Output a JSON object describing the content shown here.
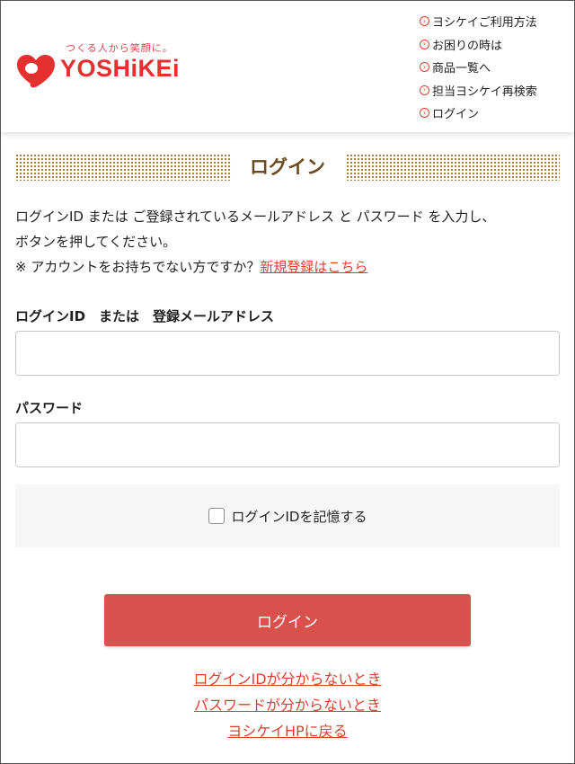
{
  "brand": {
    "tagline": "つくる人から笑顔に。",
    "name": "YOSHiKEi",
    "color": "#e4302f"
  },
  "nav": {
    "items": [
      {
        "label": "ヨシケイご利用方法"
      },
      {
        "label": "お困りの時は"
      },
      {
        "label": "商品一覧へ"
      },
      {
        "label": "担当ヨシケイ再検索"
      },
      {
        "label": "ログイン"
      }
    ],
    "icon": "circle-chevron-right-icon"
  },
  "page": {
    "title": "ログイン",
    "intro_line1": "ログインID または ご登録されているメールアドレス と パスワード を入力し、",
    "intro_line2": "ボタンを押してください。",
    "intro_line3": "※ アカウントをお持ちでない方ですか？",
    "register_link": "新規登録はこちら"
  },
  "form": {
    "login_id_label": "ログインID　または　登録メールアドレス",
    "login_id_value": "",
    "password_label": "パスワード",
    "password_value": "",
    "remember_label": "ログインIDを記憶する",
    "remember_checked": false,
    "submit_label": "ログイン"
  },
  "links": {
    "forgot_id": "ログインIDが分からないとき",
    "forgot_password": "パスワードが分からないとき",
    "back_to_hp": "ヨシケイHPに戻る"
  },
  "colors": {
    "accent": "#d9412f",
    "button": "#d9514c",
    "title_brown": "#6a4a1e",
    "dots": "#a97e42"
  }
}
